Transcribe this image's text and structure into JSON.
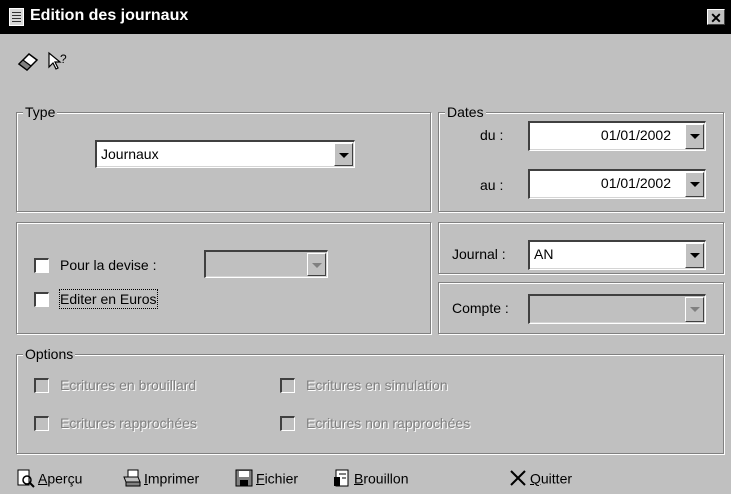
{
  "window": {
    "title": "Edition des journaux",
    "close_glyph": "✕"
  },
  "toolbar": {
    "icons": [
      "eraser-icon",
      "help-pointer-icon"
    ]
  },
  "type_group": {
    "legend": "Type",
    "selected": "Journaux"
  },
  "dates_group": {
    "legend": "Dates",
    "from_label": "du :",
    "from_value": "01/01/2002",
    "to_label": "au :",
    "to_value": "01/01/2002"
  },
  "currency_group": {
    "devise_label": "Pour la devise :",
    "devise_checked": false,
    "devise_value": "",
    "euros_label": "Editer en Euros",
    "euros_checked": false
  },
  "journal": {
    "label": "Journal :",
    "value": "AN"
  },
  "compte": {
    "label": "Compte :",
    "value": ""
  },
  "options_group": {
    "legend": "Options",
    "items": [
      {
        "label": "Ecritures en brouillard",
        "enabled": false
      },
      {
        "label": "Ecritures en simulation",
        "enabled": false
      },
      {
        "label": "Ecritures rapprochées",
        "enabled": false
      },
      {
        "label": "Ecritures non rapprochées",
        "enabled": false
      }
    ]
  },
  "actions": {
    "apercu_first": "A",
    "apercu_rest": "perçu",
    "imprimer_first": "I",
    "imprimer_rest": "mprimer",
    "fichier_first": "F",
    "fichier_rest": "ichier",
    "brouillon_first": "B",
    "brouillon_rest": "rouillon",
    "quitter_first": "Q",
    "quitter_rest": "uitter"
  }
}
